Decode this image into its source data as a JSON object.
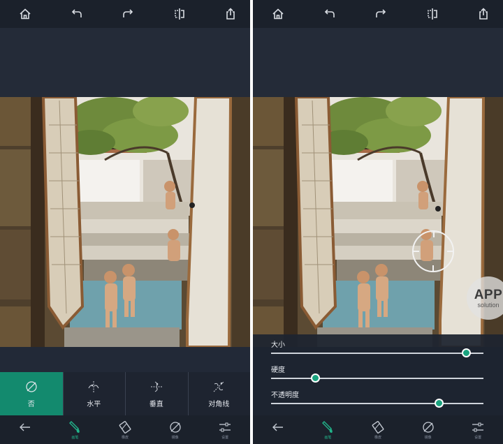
{
  "toolbar": {
    "icons": [
      "home-icon",
      "undo-icon",
      "redo-icon",
      "compare-icon",
      "share-icon"
    ]
  },
  "left": {
    "options": [
      {
        "label": "否",
        "icon": "no-symmetry-icon",
        "active": true
      },
      {
        "label": "水平",
        "icon": "horizontal-symmetry-icon",
        "active": false
      },
      {
        "label": "垂直",
        "icon": "vertical-symmetry-icon",
        "active": false
      },
      {
        "label": "对角线",
        "icon": "diagonal-symmetry-icon",
        "active": false
      }
    ]
  },
  "right": {
    "sliders": [
      {
        "label": "大小",
        "value": 0.92
      },
      {
        "label": "硬度",
        "value": 0.21
      },
      {
        "label": "不透明度",
        "value": 0.79
      }
    ],
    "watermark": {
      "big": "APP",
      "small": "solution"
    }
  },
  "nav": {
    "items": [
      {
        "icon": "back-arrow-icon",
        "label": "",
        "active": false
      },
      {
        "icon": "brush-icon",
        "label": "画笔",
        "active": true
      },
      {
        "icon": "eraser-icon",
        "label": "橡皮",
        "active": false
      },
      {
        "icon": "mirror-icon",
        "label": "镜像",
        "active": false
      },
      {
        "icon": "settings-sliders-icon",
        "label": "设置",
        "active": false
      }
    ]
  },
  "colors": {
    "accent": "#138a6e",
    "knob": "#1aa37f",
    "panel": "#1e2430"
  }
}
